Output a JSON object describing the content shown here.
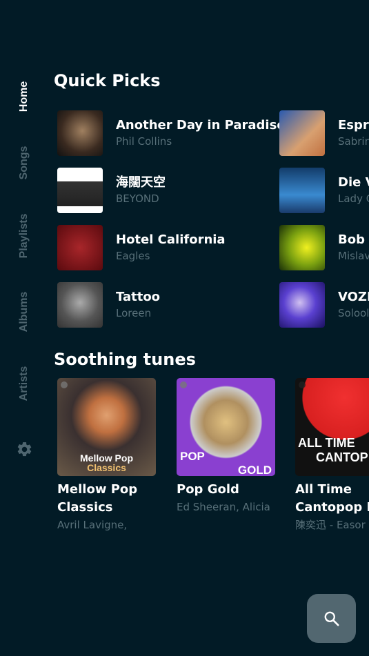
{
  "nav": {
    "items": [
      {
        "label": "Home",
        "active": true
      },
      {
        "label": "Songs",
        "active": false
      },
      {
        "label": "Playlists",
        "active": false
      },
      {
        "label": "Albums",
        "active": false
      },
      {
        "label": "Artists",
        "active": false
      }
    ],
    "settings_icon": "gear-icon"
  },
  "quick_picks": {
    "title": "Quick Picks",
    "items": [
      {
        "title": "Another Day in Paradise",
        "artist": "Phil Collins"
      },
      {
        "title": "海闊天空",
        "artist": "BEYOND"
      },
      {
        "title": "Hotel California",
        "artist": "Eagles"
      },
      {
        "title": "Tattoo",
        "artist": "Loreen"
      },
      {
        "title": "Espre",
        "artist": "Sabrin"
      },
      {
        "title": "Die V",
        "artist": "Lady G"
      },
      {
        "title": "Bob M",
        "artist": "Mislav"
      },
      {
        "title": "VOZE",
        "artist": "Solool"
      }
    ]
  },
  "soothing": {
    "title": "Soothing tunes",
    "items": [
      {
        "title1": "Mellow Pop",
        "title2": "Classics",
        "subtitle": "Avril Lavigne,",
        "art_line1": "Mellow Pop",
        "art_line2": "Classics"
      },
      {
        "title1": "Pop Gold",
        "title2": "",
        "subtitle": "Ed Sheeran, Alicia",
        "art_line1": "POP",
        "art_line2": "GOLD"
      },
      {
        "title1": "All Time",
        "title2": "Cantopop H",
        "subtitle": "陳奕迅 - Easor",
        "art_line1": "ALL TIME",
        "art_line2": "CANTOP"
      }
    ]
  },
  "search_button": {
    "icon": "search-icon"
  },
  "colors": {
    "background": "#021b26",
    "inactive": "#4f6670",
    "fab": "#526770"
  }
}
